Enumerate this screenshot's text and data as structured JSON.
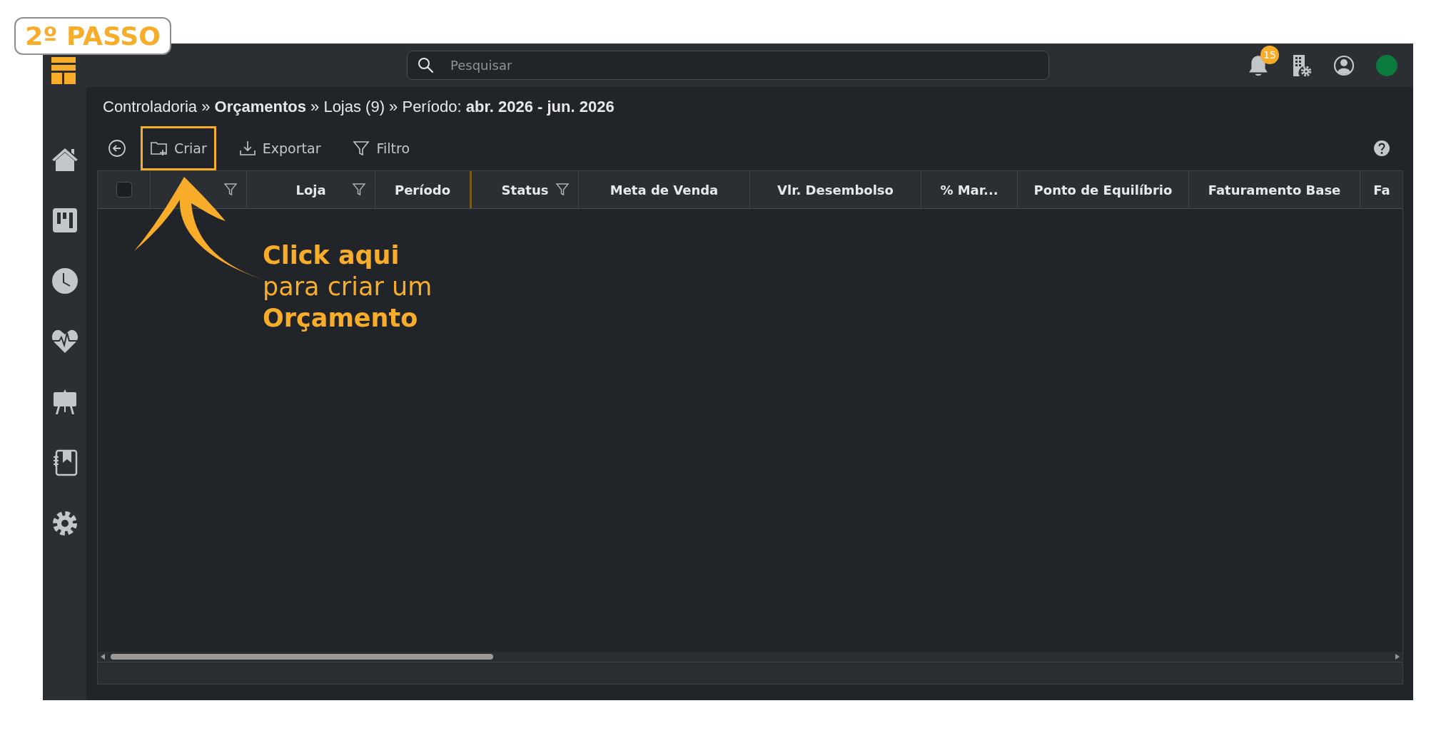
{
  "step_badge": "2º PASSO",
  "search": {
    "placeholder": "Pesquisar"
  },
  "notifications": {
    "count": "15"
  },
  "status": {
    "color": "#0a7a3f"
  },
  "breadcrumb": "Controladoria » **Orçamentos** » Lojas (9) » Período: **abr. 2026 - jun. 2026**",
  "toolbar": [
    {
      "kind": "back"
    },
    {
      "kind": "create",
      "label": "Criar",
      "highlighted": true
    },
    {
      "kind": "export",
      "label": "Exportar",
      "highlighted": false
    },
    {
      "kind": "filter",
      "label": "Filtro",
      "highlighted": false
    }
  ],
  "table": {
    "columns": [
      {
        "kind": "select",
        "checked": false,
        "filter": false,
        "divider_marked": false
      },
      {
        "kind": "blank",
        "filter": true,
        "divider_marked": false
      },
      {
        "kind": "text",
        "label": "Loja",
        "filter": true,
        "divider_marked": false
      },
      {
        "kind": "text",
        "label": "Período",
        "filter": false,
        "divider_marked": true
      },
      {
        "kind": "text",
        "label": "Status",
        "filter": true,
        "divider_marked": false
      },
      {
        "kind": "text",
        "label": "Meta de Venda",
        "filter": false,
        "divider_marked": false
      },
      {
        "kind": "text",
        "label": "Vlr. Desembolso",
        "filter": false,
        "divider_marked": false
      },
      {
        "kind": "text",
        "label": "% Mar...",
        "filter": false,
        "divider_marked": false
      },
      {
        "kind": "text",
        "label": "Ponto de Equilíbrio",
        "filter": false,
        "divider_marked": false
      },
      {
        "kind": "text",
        "label": "Faturamento Base",
        "filter": false,
        "divider_marked": false
      },
      {
        "kind": "text",
        "label": "Fa",
        "filter": false,
        "divider_marked": false
      }
    ]
  },
  "annotation": {
    "lines": [
      {
        "text": "Click aqui",
        "bold": true
      },
      {
        "text": "para criar um",
        "bold": false
      },
      {
        "text": "Orçamento",
        "bold": true
      }
    ]
  }
}
